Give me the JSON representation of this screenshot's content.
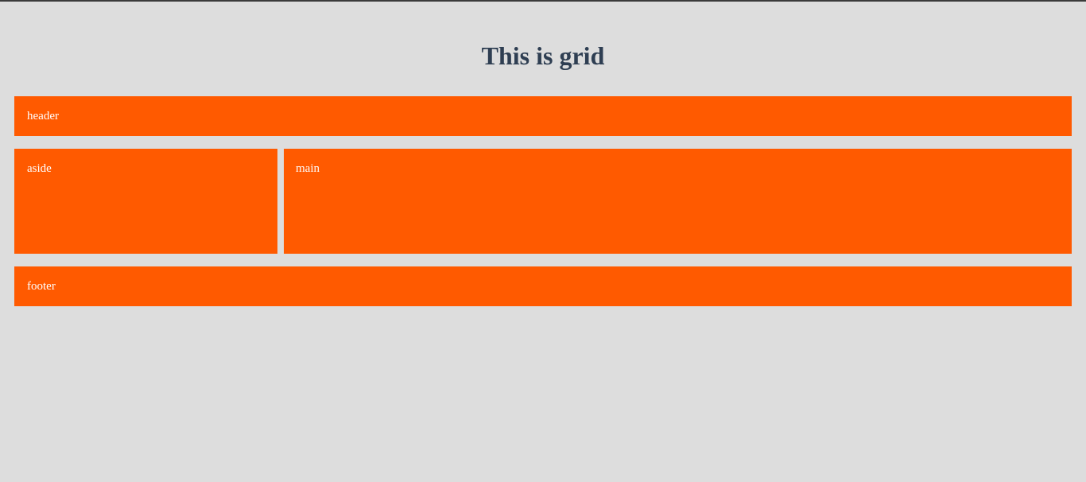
{
  "page": {
    "title": "This is grid"
  },
  "grid": {
    "header_label": "header",
    "aside_label": "aside",
    "main_label": "main",
    "footer_label": "footer"
  },
  "colors": {
    "background": "#dddddd",
    "title": "#2e3e52",
    "block": "#ff5a00",
    "block_text": "#ffffff"
  }
}
